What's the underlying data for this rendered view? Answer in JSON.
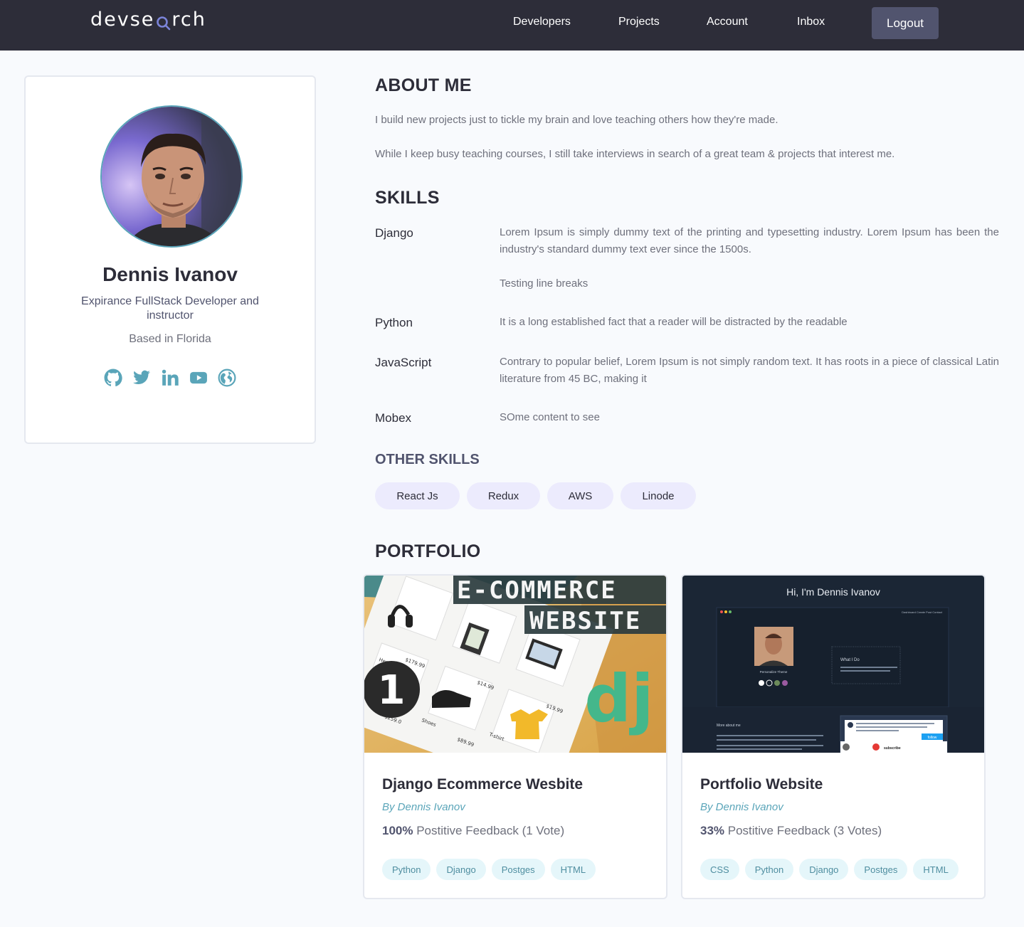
{
  "brand": {
    "logo": "devsearch"
  },
  "nav": {
    "links": [
      "Developers",
      "Projects",
      "Account",
      "Inbox"
    ],
    "logout": "Logout"
  },
  "profile": {
    "name": "Dennis Ivanov",
    "title": "Expirance FullStack Developer and instructor",
    "location": "Based in Florida",
    "socials": [
      "github-icon",
      "twitter-icon",
      "linkedin-icon",
      "youtube-icon",
      "globe-icon"
    ]
  },
  "about": {
    "heading": "ABOUT ME",
    "paragraphs": [
      "I build new projects just to tickle my brain and love teaching others how they're made.",
      "While I keep busy teaching courses, I still take interviews in search of a great team & projects that interest me."
    ]
  },
  "skills": {
    "heading": "SKILLS",
    "items": [
      {
        "name": "Django",
        "desc": "Lorem Ipsum is simply dummy text of the printing and typesetting industry. Lorem Ipsum has been the industry's standard dummy text ever since the 1500s.",
        "extra": "Testing line breaks"
      },
      {
        "name": "Python",
        "desc": "It is a long established fact that a reader will be distracted by the readable"
      },
      {
        "name": "JavaScript",
        "desc": "Contrary to popular belief, Lorem Ipsum is not simply random text. It has roots in a piece of classical Latin literature from 45 BC, making it"
      },
      {
        "name": "Mobex",
        "desc": "SOme content to see"
      }
    ]
  },
  "other_skills": {
    "heading": "OTHER SKILLS",
    "items": [
      "React Js",
      "Redux",
      "AWS",
      "Linode"
    ]
  },
  "portfolio": {
    "heading": "PORTFOLIO",
    "projects": [
      {
        "title": "Django Ecommerce Wesbite",
        "author": "By Dennis Ivanov",
        "feedback_pct": "100%",
        "feedback_text": "Postitive Feedback (1 Vote)",
        "tags": [
          "Python",
          "Django",
          "Postges",
          "HTML"
        ],
        "thumb": {
          "line1": "E-COMMERCE",
          "line2": "WEBSITE",
          "number": "1",
          "logo": "dj",
          "prices": [
            "$179.99",
            "$14.99",
            "$19.99",
            "$89.99",
            "$259.0"
          ],
          "labels": [
            "Headphones",
            "Shoes",
            "T-shirt"
          ]
        }
      },
      {
        "title": "Portfolio Website",
        "author": "By Dennis Ivanov",
        "feedback_pct": "33%",
        "feedback_text": "Postitive Feedback (3 Votes)",
        "tags": [
          "CSS",
          "Python",
          "Django",
          "Postges",
          "HTML"
        ],
        "thumb": {
          "heading": "Hi, I'm Dennis Ivanov",
          "nav": "Dashboard   Create Post   Contact",
          "theme_label": "Personalize Theme",
          "what_i_do": "What I Do",
          "more_about": "More about me",
          "follow": "follow",
          "subscribe": "subscribe"
        }
      }
    ]
  },
  "colors": {
    "header_bg": "#2d2d39",
    "accent": "#5aa5b9",
    "chip_bg": "#ecebfd",
    "tag_bg": "#e5f6fa"
  }
}
